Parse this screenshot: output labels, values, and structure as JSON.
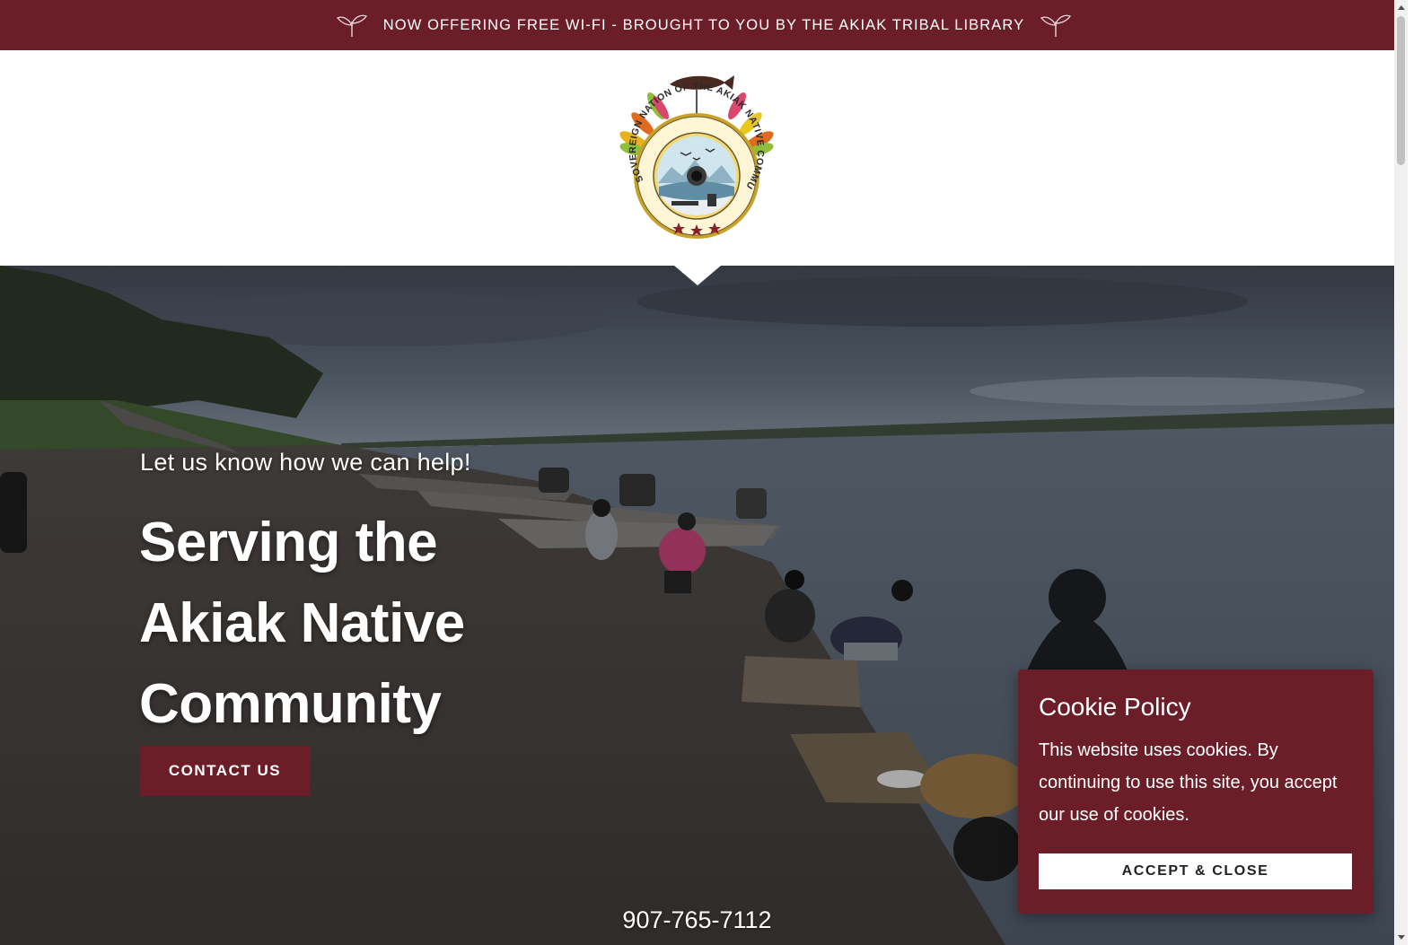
{
  "announcement": {
    "text": "NOW OFFERING FREE WI-FI - BROUGHT TO YOU BY THE AKIAK TRIBAL LIBRARY",
    "icon": "sprout-icon"
  },
  "logo": {
    "ring_text": "SOVEREIGN NATION OF THE AKIAK NATIVE COMMUNITY",
    "icon": "tribal-seal-logo"
  },
  "hero": {
    "kicker": "Let us know how we can help!",
    "headline_lines": [
      "Serving the",
      "Akiak Native",
      "Community"
    ],
    "cta_label": "CONTACT US",
    "phone": "907-765-7112"
  },
  "cookie": {
    "title": "Cookie Policy",
    "body": "This website uses cookies. By continuing to use this site, you accept our use of cookies.",
    "button_label": "ACCEPT & CLOSE"
  },
  "colors": {
    "brand": "#6b1e28",
    "white": "#ffffff"
  }
}
